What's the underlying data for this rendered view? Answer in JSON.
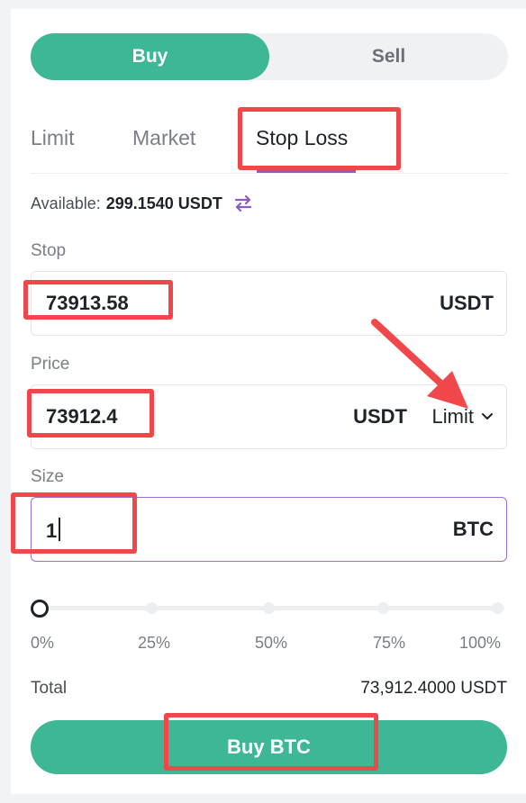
{
  "side_toggle": {
    "buy_label": "Buy",
    "sell_label": "Sell",
    "selected": "Buy"
  },
  "order_tabs": {
    "items": [
      "Limit",
      "Market",
      "Stop Loss"
    ],
    "active": "Stop Loss"
  },
  "available": {
    "label": "Available:",
    "value": "299.1540 USDT",
    "icon": "swap-icon"
  },
  "stop": {
    "label": "Stop",
    "value": "73913.58",
    "unit": "USDT"
  },
  "price": {
    "label": "Price",
    "value": "73912.4",
    "unit": "USDT",
    "type": "Limit",
    "type_icon": "chevron-down-icon"
  },
  "size": {
    "label": "Size",
    "value": "1",
    "unit": "BTC"
  },
  "slider": {
    "marks": [
      "0%",
      "25%",
      "50%",
      "75%",
      "100%"
    ],
    "value_percent": 0
  },
  "total": {
    "label": "Total",
    "value": "73,912.4000 USDT"
  },
  "submit": {
    "label": "Buy BTC"
  },
  "colors": {
    "accent": "#3db795",
    "tab_underline": "#8b5cc7",
    "highlight": "#f0484a"
  }
}
